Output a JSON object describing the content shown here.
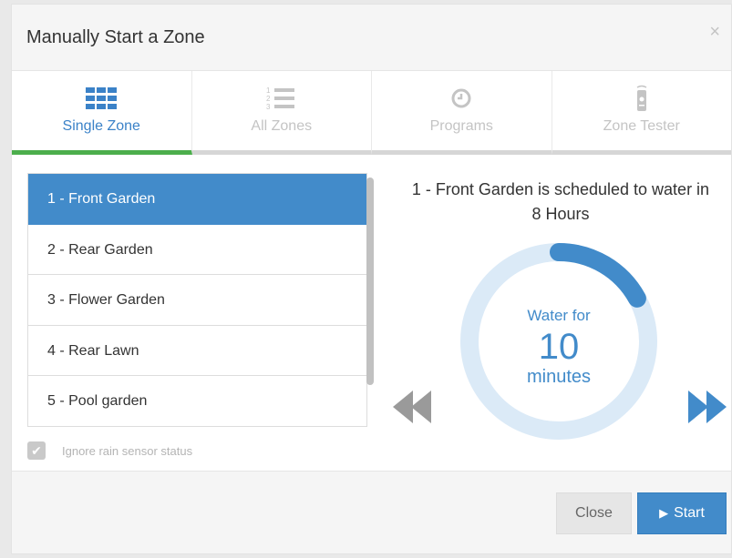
{
  "dialog": {
    "title": "Manually Start a Zone",
    "close_glyph": "×"
  },
  "tabs": [
    {
      "label": "Single Zone",
      "icon": "grid-icon",
      "active": true
    },
    {
      "label": "All Zones",
      "icon": "numbered-list-icon",
      "active": false
    },
    {
      "label": "Programs",
      "icon": "clock-icon",
      "active": false
    },
    {
      "label": "Zone Tester",
      "icon": "remote-control-icon",
      "active": false
    }
  ],
  "zones": [
    {
      "label": "1 - Front Garden",
      "selected": true
    },
    {
      "label": "2 - Rear Garden",
      "selected": false
    },
    {
      "label": "3 - Flower Garden",
      "selected": false
    },
    {
      "label": "4 - Rear Lawn",
      "selected": false
    },
    {
      "label": "5 - Pool garden",
      "selected": false
    }
  ],
  "ignore_rain": {
    "label": "Ignore rain sensor status",
    "checked": true
  },
  "schedule": {
    "text": "1 - Front Garden is scheduled to water in 8 Hours"
  },
  "dial": {
    "caption": "Water for",
    "value": "10",
    "unit": "minutes",
    "fraction": 0.17
  },
  "footer": {
    "close_label": "Close",
    "start_label": "Start"
  },
  "colors": {
    "accent": "#428bca",
    "active_tab_underline": "#4cae4c",
    "ring_track": "#dbeaf7",
    "ring_progress": "#428bca",
    "muted": "#c4c4c4"
  }
}
